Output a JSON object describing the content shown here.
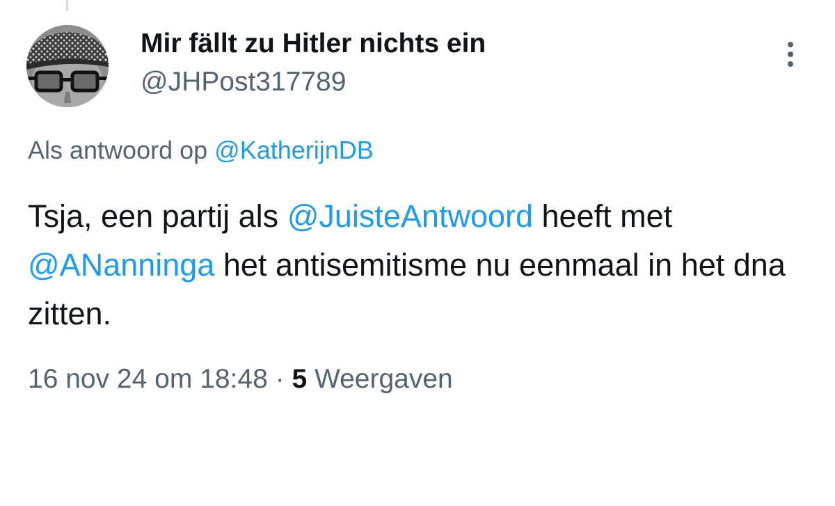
{
  "author": {
    "display_name": "Mir fällt zu Hitler nichts ein",
    "handle": "@JHPost317789"
  },
  "reply": {
    "prefix": "Als antwoord op",
    "mention": "@KatherijnDB"
  },
  "tweet": {
    "text_1": "Tsja, een partij als ",
    "mention_1": "@JuisteAntwoord",
    "text_2": " heeft met ",
    "mention_2": "@ANanninga",
    "text_3": " het antisemitisme nu eenmaal in het dna zitten."
  },
  "meta": {
    "timestamp": "16 nov 24 om 18:48",
    "separator": "·",
    "views_count": "5",
    "views_label": "Weergaven"
  },
  "colors": {
    "accent": "#1d9bf0",
    "text": "#0f1419",
    "secondary": "#536471"
  },
  "icons": {
    "more": "more-vertical-icon"
  }
}
